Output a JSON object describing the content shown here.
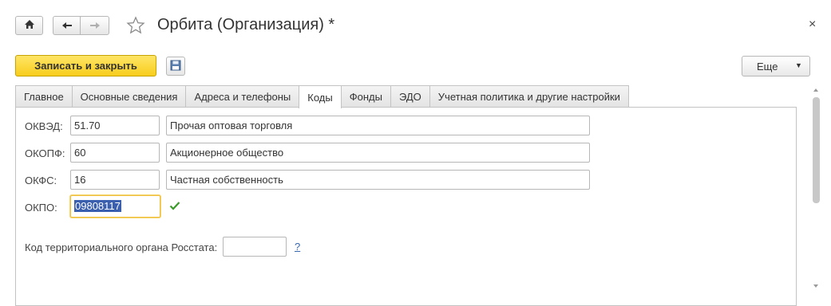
{
  "window": {
    "title": "Орбита (Организация) *",
    "close_glyph": "×"
  },
  "toolbar": {
    "save_close_label": "Записать и закрыть",
    "more_label": "Еще",
    "more_arrow": "▼"
  },
  "tabs": [
    {
      "label": "Главное",
      "active": false
    },
    {
      "label": "Основные сведения",
      "active": false
    },
    {
      "label": "Адреса и телефоны",
      "active": false
    },
    {
      "label": "Коды",
      "active": true
    },
    {
      "label": "Фонды",
      "active": false
    },
    {
      "label": "ЭДО",
      "active": false
    },
    {
      "label": "Учетная политика и другие настройки",
      "active": false
    }
  ],
  "codes": {
    "okved": {
      "label": "ОКВЭД:",
      "code": "51.70",
      "description": "Прочая оптовая торговля"
    },
    "okopf": {
      "label": "ОКОПФ:",
      "code": "60",
      "description": "Акционерное общество"
    },
    "okfs": {
      "label": "ОКФС:",
      "code": "16",
      "description": "Частная собственность"
    },
    "okpo": {
      "label": "ОКПО:",
      "code": "09808117"
    },
    "rosstat": {
      "label": "Код территориального органа Росстата:",
      "value": "",
      "help": "?"
    }
  },
  "colors": {
    "accent_yellow": "#f7cd1c",
    "selection": "#3a5faf",
    "check_green": "#3a9a2a",
    "help_link": "#3a68b0"
  }
}
